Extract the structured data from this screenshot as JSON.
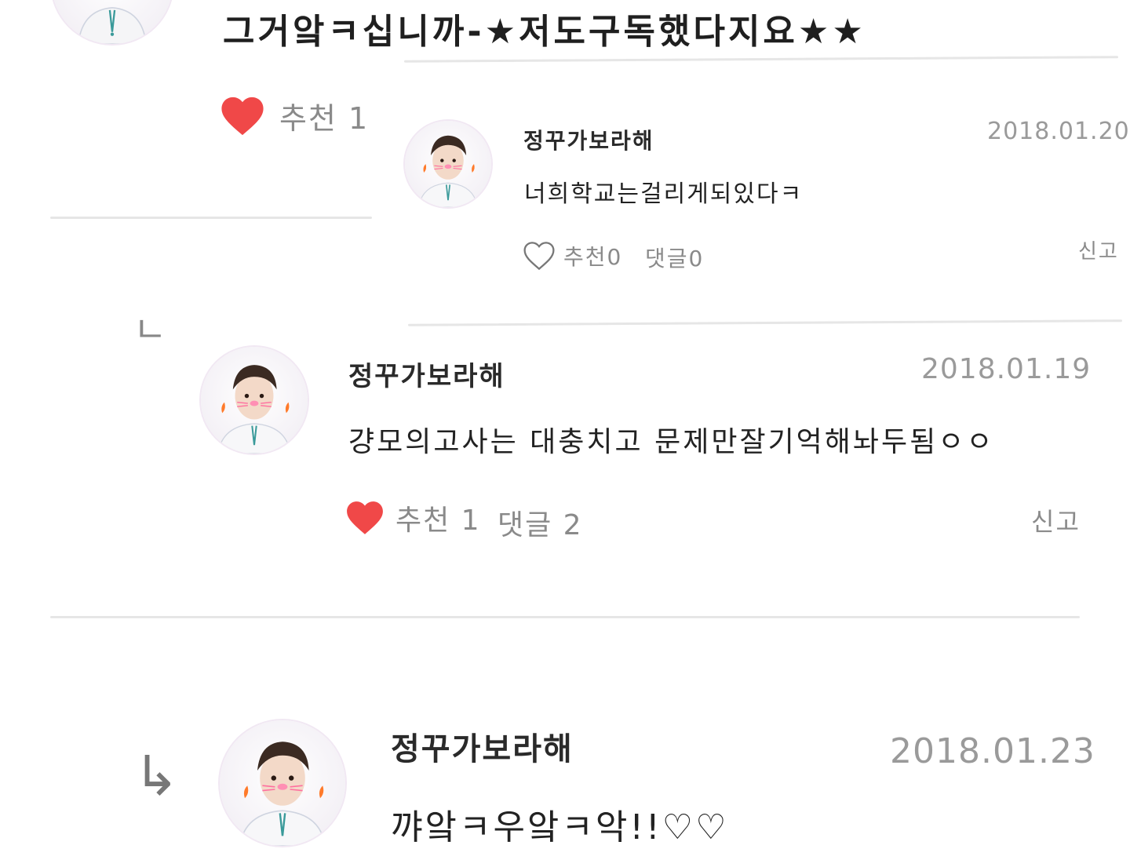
{
  "top_comment": {
    "text": "그거앜ㅋ십니까-★저도구독했다지요★★",
    "likes_label": "추천 1",
    "heart_color": "#f04848"
  },
  "reply_1": {
    "author": "정꾸가보라해",
    "date": "2018.01.20",
    "text": "너희학교는걸리게되있다ㅋ",
    "likes_label": "추천0",
    "comments_label": "댓글0",
    "report_label": "신고"
  },
  "reply_2": {
    "indent_marker": "ㄴ",
    "author": "정꾸가보라해",
    "date": "2018.01.19",
    "text": "걍모의고사는 대충치고 문제만잘기억해놔두됨ㅇㅇ",
    "likes_label": "추천 1",
    "comments_label": "댓글 2",
    "report_label": "신고",
    "heart_color": "#f04848"
  },
  "reply_3": {
    "arrow": "↳",
    "author": "정꾸가보라해",
    "date": "2018.01.23",
    "text": "꺄앜ㅋ우앜ㅋ악!!♡♡"
  }
}
